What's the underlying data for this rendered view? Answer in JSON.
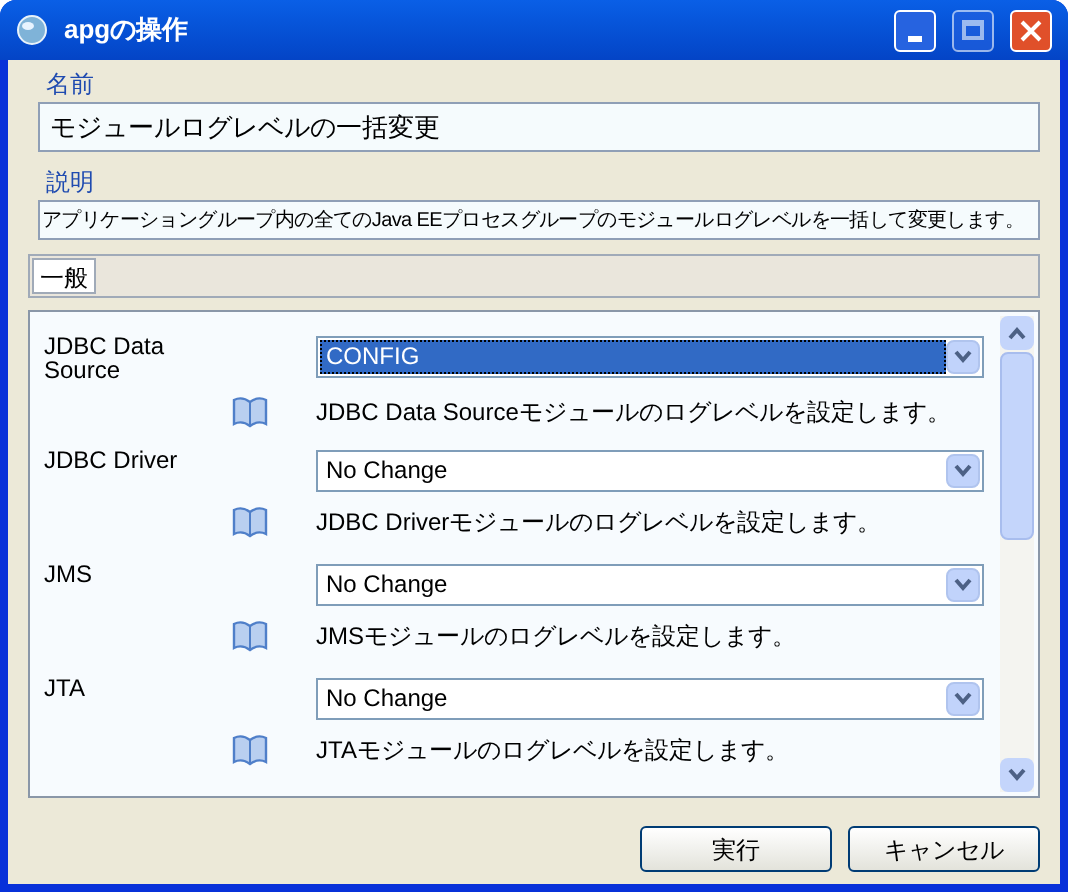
{
  "window": {
    "title": "apgの操作"
  },
  "name_field": {
    "label": "名前",
    "value": "モジュールログレベルの一括変更"
  },
  "description_field": {
    "label": "説明",
    "value": "アプリケーショングループ内の全てのJava EEプロセスグループのモジュールログレベルを一括して変更します。"
  },
  "tabs": [
    {
      "label": "一般",
      "selected": true
    }
  ],
  "settings": [
    {
      "label": "JDBC Data Source",
      "value": "CONFIG",
      "focused": true,
      "help": "JDBC Data Sourceモジュールのログレベルを設定します。"
    },
    {
      "label": "JDBC Driver",
      "value": "No Change",
      "focused": false,
      "help": "JDBC Driverモジュールのログレベルを設定します。"
    },
    {
      "label": "JMS",
      "value": "No Change",
      "focused": false,
      "help": "JMSモジュールのログレベルを設定します。"
    },
    {
      "label": "JTA",
      "value": "No Change",
      "focused": false,
      "help": "JTAモジュールのログレベルを設定します。"
    }
  ],
  "buttons": [
    "実行",
    "キャンセル"
  ]
}
